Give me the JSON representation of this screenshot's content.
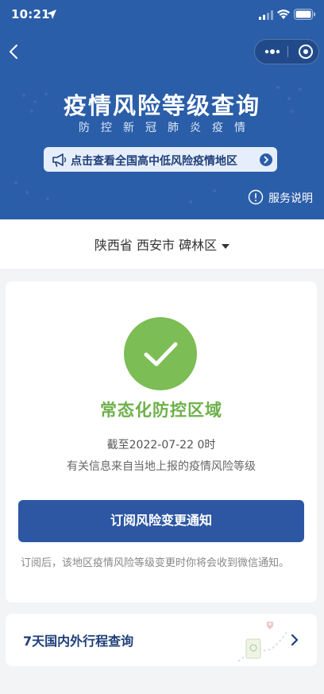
{
  "status_bar": {
    "time": "10:21"
  },
  "header": {
    "title": "疫情风险等级查询",
    "subtitle": "防控新冠肺炎疫情",
    "notice_text": "点击查看全国高中低风险疫情地区",
    "service_link": "服务说明"
  },
  "region": {
    "selected": "陕西省 西安市 碑林区"
  },
  "result": {
    "risk_level": "常态化防控区域",
    "as_of": "截至2022-07-22 0时",
    "source": "有关信息来自当地上报的疫情风险等级",
    "subscribe_label": "订阅风险变更通知",
    "subscribe_note": "订阅后，该地区疫情风险等级变更时你将会收到微信通知。"
  },
  "trip": {
    "label": "7天国内外行程查询"
  },
  "colors": {
    "header_bg": "#2b5ea9",
    "primary_button": "#2d57a3",
    "low_risk_green": "#7cbd55"
  },
  "icons": [
    "location-arrow-icon",
    "signal-icon",
    "wifi-icon",
    "battery-icon",
    "back-icon",
    "more-dots-icon",
    "target-close-icon",
    "megaphone-icon",
    "arrow-right-circle-icon",
    "info-circle-icon",
    "caret-down-icon",
    "checkmark-icon",
    "chevron-right-icon"
  ]
}
